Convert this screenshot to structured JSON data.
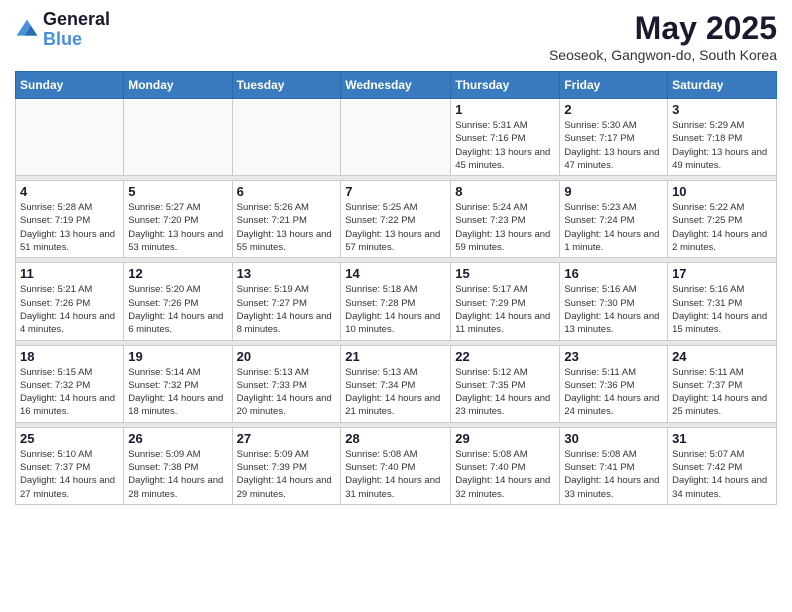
{
  "logo": {
    "line1": "General",
    "line2": "Blue"
  },
  "title": "May 2025",
  "subtitle": "Seoseok, Gangwon-do, South Korea",
  "days_of_week": [
    "Sunday",
    "Monday",
    "Tuesday",
    "Wednesday",
    "Thursday",
    "Friday",
    "Saturday"
  ],
  "weeks": [
    [
      {
        "day": "",
        "info": ""
      },
      {
        "day": "",
        "info": ""
      },
      {
        "day": "",
        "info": ""
      },
      {
        "day": "",
        "info": ""
      },
      {
        "day": "1",
        "info": "Sunrise: 5:31 AM\nSunset: 7:16 PM\nDaylight: 13 hours and 45 minutes."
      },
      {
        "day": "2",
        "info": "Sunrise: 5:30 AM\nSunset: 7:17 PM\nDaylight: 13 hours and 47 minutes."
      },
      {
        "day": "3",
        "info": "Sunrise: 5:29 AM\nSunset: 7:18 PM\nDaylight: 13 hours and 49 minutes."
      }
    ],
    [
      {
        "day": "4",
        "info": "Sunrise: 5:28 AM\nSunset: 7:19 PM\nDaylight: 13 hours and 51 minutes."
      },
      {
        "day": "5",
        "info": "Sunrise: 5:27 AM\nSunset: 7:20 PM\nDaylight: 13 hours and 53 minutes."
      },
      {
        "day": "6",
        "info": "Sunrise: 5:26 AM\nSunset: 7:21 PM\nDaylight: 13 hours and 55 minutes."
      },
      {
        "day": "7",
        "info": "Sunrise: 5:25 AM\nSunset: 7:22 PM\nDaylight: 13 hours and 57 minutes."
      },
      {
        "day": "8",
        "info": "Sunrise: 5:24 AM\nSunset: 7:23 PM\nDaylight: 13 hours and 59 minutes."
      },
      {
        "day": "9",
        "info": "Sunrise: 5:23 AM\nSunset: 7:24 PM\nDaylight: 14 hours and 1 minute."
      },
      {
        "day": "10",
        "info": "Sunrise: 5:22 AM\nSunset: 7:25 PM\nDaylight: 14 hours and 2 minutes."
      }
    ],
    [
      {
        "day": "11",
        "info": "Sunrise: 5:21 AM\nSunset: 7:26 PM\nDaylight: 14 hours and 4 minutes."
      },
      {
        "day": "12",
        "info": "Sunrise: 5:20 AM\nSunset: 7:26 PM\nDaylight: 14 hours and 6 minutes."
      },
      {
        "day": "13",
        "info": "Sunrise: 5:19 AM\nSunset: 7:27 PM\nDaylight: 14 hours and 8 minutes."
      },
      {
        "day": "14",
        "info": "Sunrise: 5:18 AM\nSunset: 7:28 PM\nDaylight: 14 hours and 10 minutes."
      },
      {
        "day": "15",
        "info": "Sunrise: 5:17 AM\nSunset: 7:29 PM\nDaylight: 14 hours and 11 minutes."
      },
      {
        "day": "16",
        "info": "Sunrise: 5:16 AM\nSunset: 7:30 PM\nDaylight: 14 hours and 13 minutes."
      },
      {
        "day": "17",
        "info": "Sunrise: 5:16 AM\nSunset: 7:31 PM\nDaylight: 14 hours and 15 minutes."
      }
    ],
    [
      {
        "day": "18",
        "info": "Sunrise: 5:15 AM\nSunset: 7:32 PM\nDaylight: 14 hours and 16 minutes."
      },
      {
        "day": "19",
        "info": "Sunrise: 5:14 AM\nSunset: 7:32 PM\nDaylight: 14 hours and 18 minutes."
      },
      {
        "day": "20",
        "info": "Sunrise: 5:13 AM\nSunset: 7:33 PM\nDaylight: 14 hours and 20 minutes."
      },
      {
        "day": "21",
        "info": "Sunrise: 5:13 AM\nSunset: 7:34 PM\nDaylight: 14 hours and 21 minutes."
      },
      {
        "day": "22",
        "info": "Sunrise: 5:12 AM\nSunset: 7:35 PM\nDaylight: 14 hours and 23 minutes."
      },
      {
        "day": "23",
        "info": "Sunrise: 5:11 AM\nSunset: 7:36 PM\nDaylight: 14 hours and 24 minutes."
      },
      {
        "day": "24",
        "info": "Sunrise: 5:11 AM\nSunset: 7:37 PM\nDaylight: 14 hours and 25 minutes."
      }
    ],
    [
      {
        "day": "25",
        "info": "Sunrise: 5:10 AM\nSunset: 7:37 PM\nDaylight: 14 hours and 27 minutes."
      },
      {
        "day": "26",
        "info": "Sunrise: 5:09 AM\nSunset: 7:38 PM\nDaylight: 14 hours and 28 minutes."
      },
      {
        "day": "27",
        "info": "Sunrise: 5:09 AM\nSunset: 7:39 PM\nDaylight: 14 hours and 29 minutes."
      },
      {
        "day": "28",
        "info": "Sunrise: 5:08 AM\nSunset: 7:40 PM\nDaylight: 14 hours and 31 minutes."
      },
      {
        "day": "29",
        "info": "Sunrise: 5:08 AM\nSunset: 7:40 PM\nDaylight: 14 hours and 32 minutes."
      },
      {
        "day": "30",
        "info": "Sunrise: 5:08 AM\nSunset: 7:41 PM\nDaylight: 14 hours and 33 minutes."
      },
      {
        "day": "31",
        "info": "Sunrise: 5:07 AM\nSunset: 7:42 PM\nDaylight: 14 hours and 34 minutes."
      }
    ]
  ]
}
